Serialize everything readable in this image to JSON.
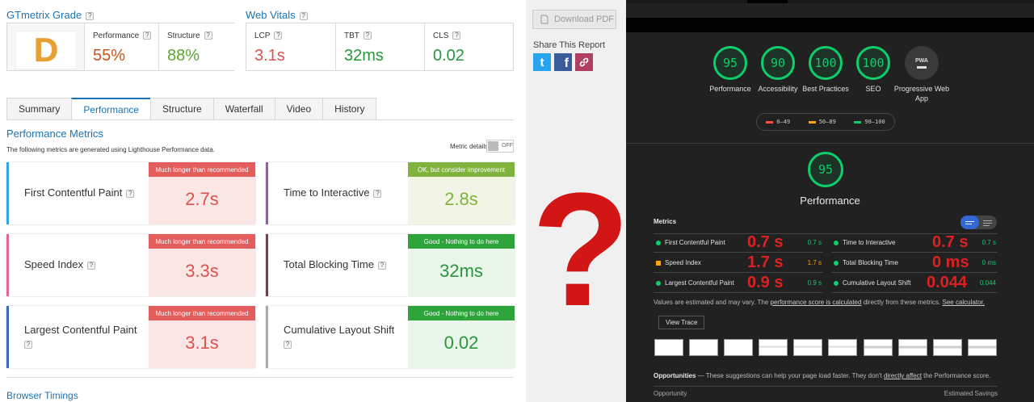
{
  "gtmetrix": {
    "grade_title": "GTmetrix Grade",
    "grade_letter": "D",
    "performance_label": "Performance",
    "performance_value": "55%",
    "structure_label": "Structure",
    "structure_value": "88%",
    "vitals_title": "Web Vitals",
    "lcp_label": "LCP",
    "lcp_value": "3.1s",
    "tbt_label": "TBT",
    "tbt_value": "32ms",
    "cls_label": "CLS",
    "cls_value": "0.02",
    "help_glyph": "?"
  },
  "tabs": [
    {
      "label": "Summary",
      "active": false
    },
    {
      "label": "Performance",
      "active": true
    },
    {
      "label": "Structure",
      "active": false
    },
    {
      "label": "Waterfall",
      "active": false
    },
    {
      "label": "Video",
      "active": false
    },
    {
      "label": "History",
      "active": false
    }
  ],
  "perf": {
    "title": "Performance Metrics",
    "description": "The following metrics are generated using Lighthouse Performance data.",
    "metric_details_label": "Metric details",
    "toggle_label": "OFF",
    "cards": [
      {
        "name": "First Contentful Paint",
        "tag": "Much longer than recommended",
        "value": "2.7s",
        "color": "#d9534f"
      },
      {
        "name": "Time to Interactive",
        "tag": "OK, but consider improvement",
        "value": "2.8s",
        "color": "#7fb33d"
      },
      {
        "name": "Speed Index",
        "tag": "Much longer than recommended",
        "value": "3.3s",
        "color": "#d9534f"
      },
      {
        "name": "Total Blocking Time",
        "tag": "Good - Nothing to do here",
        "value": "32ms",
        "color": "#27973a"
      },
      {
        "name": "Largest Contentful Paint",
        "tag": "Much longer than recommended",
        "value": "3.1s",
        "color": "#d9534f"
      },
      {
        "name": "Cumulative Layout Shift",
        "tag": "Good - Nothing to do here",
        "value": "0.02",
        "color": "#27973a"
      }
    ],
    "browser_timings": "Browser Timings"
  },
  "side": {
    "download_pdf": "Download PDF",
    "share_title": "Share This Report",
    "twitter_glyph": "t",
    "facebook_glyph": "f"
  },
  "question_mark": "?",
  "lighthouse": {
    "scores": [
      {
        "value": "95",
        "label": "Performance"
      },
      {
        "value": "90",
        "label": "Accessibility"
      },
      {
        "value": "100",
        "label": "Best Practices"
      },
      {
        "value": "100",
        "label": "SEO"
      }
    ],
    "pwa_label": "Progressive Web App",
    "pwa_badge": "PWA",
    "legend": [
      "0–49",
      "50–89",
      "90–100"
    ],
    "main_score": "95",
    "main_label": "Performance",
    "metrics_title": "Metrics",
    "metrics": [
      {
        "name": "First Contentful Paint",
        "big": "0.7 s",
        "small": "0.7 s",
        "status": "good"
      },
      {
        "name": "Time to Interactive",
        "big": "0.7 s",
        "small": "0.7 s",
        "status": "good"
      },
      {
        "name": "Speed Index",
        "big": "1.7 s",
        "small": "1.7 s",
        "status": "average"
      },
      {
        "name": "Total Blocking Time",
        "big": "0 ms",
        "small": "0 ms",
        "status": "good"
      },
      {
        "name": "Largest Contentful Paint",
        "big": "0.9 s",
        "small": "0.9 s",
        "status": "good"
      },
      {
        "name": "Cumulative Layout Shift",
        "big": "0.044",
        "small": "0.044",
        "status": "good"
      }
    ],
    "note_prefix": "Values are estimated and may vary. The ",
    "note_link1": "performance score is calculated",
    "note_mid": " directly from these metrics. ",
    "note_link2": "See calculator.",
    "view_trace": "View Trace",
    "opp_title": "Opportunities",
    "opp_desc": " — These suggestions can help your page load faster. They don't ",
    "opp_link": "directly affect",
    "opp_tail": " the Performance score.",
    "col_opportunity": "Opportunity",
    "col_savings": "Estimated Savings"
  },
  "colors": {
    "gt_blue": "#1a73b5",
    "bad": "#d9534f",
    "good": "#27973a",
    "lh_green": "#0cce6b",
    "lh_orange": "#ffa400",
    "lh_red": "#ff4e42"
  }
}
